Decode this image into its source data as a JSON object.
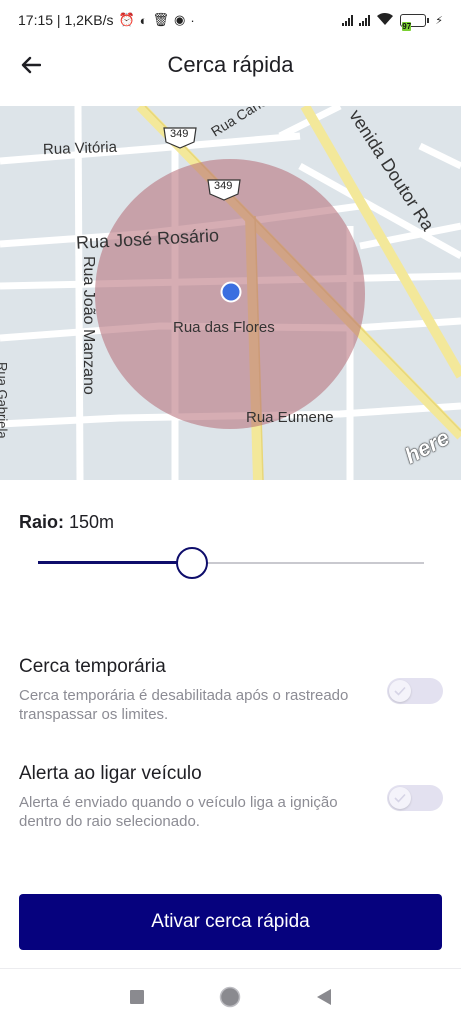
{
  "status_bar": {
    "time_speed": "17:15 | 1,2KB/s",
    "battery": "97"
  },
  "header": {
    "title": "Cerca rápida"
  },
  "map": {
    "streets": {
      "rua_vitoria": "Rua Vitória",
      "rua_jose_rosario": "Rua José Rosário",
      "rua_das_flores": "Rua das Flores",
      "rua_joao_manzano": "Rua João Manzano",
      "rua_eumene": "Rua Eumene",
      "rua_carlos": "Rua Carlo",
      "avenida": "venida Doutor Ra",
      "rua_gabriela": "Rua Gabriela"
    },
    "route_shield": "349",
    "logo": "here",
    "colors": {
      "geofence": "#b56a74",
      "marker": "#3b6fe0",
      "road_major": "#f6ec9a"
    }
  },
  "radius": {
    "label": "Raio:",
    "value": "150m",
    "slider_fraction": 0.4
  },
  "settings": [
    {
      "title": "Cerca temporária",
      "description": "Cerca temporária é desabilitada após o rastreado transpassar os limites.",
      "enabled": false
    },
    {
      "title": "Alerta ao ligar veículo",
      "description": "Alerta é enviado quando o veículo liga a ignição dentro do raio selecionado.",
      "enabled": false
    }
  ],
  "primary_action": {
    "label": "Ativar cerca rápida",
    "color": "#06027e"
  },
  "nav_bar": {
    "icons": [
      "recents-square-icon",
      "home-circle-icon",
      "back-triangle-icon"
    ]
  }
}
